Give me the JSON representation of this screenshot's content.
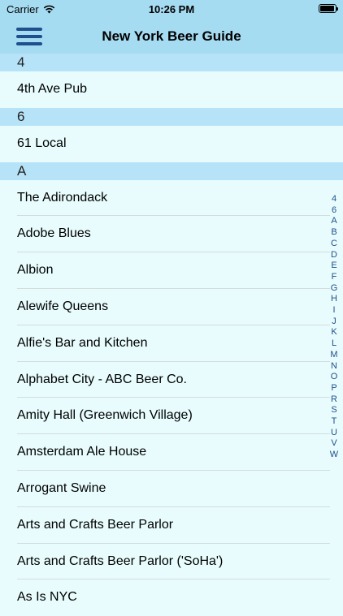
{
  "status": {
    "carrier": "Carrier",
    "time": "10:26 PM"
  },
  "nav": {
    "title": "New York Beer Guide"
  },
  "sections": [
    {
      "header": "4",
      "items": [
        "4th Ave Pub"
      ]
    },
    {
      "header": "6",
      "items": [
        "61 Local"
      ]
    },
    {
      "header": "A",
      "items": [
        "The Adirondack",
        "Adobe Blues",
        "Albion",
        "Alewife Queens",
        "Alfie's Bar and Kitchen",
        "Alphabet City - ABC Beer Co.",
        "Amity Hall (Greenwich Village)",
        "Amsterdam Ale House",
        "Arrogant Swine",
        "Arts and Crafts Beer Parlor",
        "Arts and Crafts Beer Parlor ('SoHa')",
        "As Is NYC"
      ]
    }
  ],
  "index": [
    "4",
    "6",
    "A",
    "B",
    "C",
    "D",
    "E",
    "F",
    "G",
    "H",
    "I",
    "J",
    "K",
    "L",
    "M",
    "N",
    "O",
    "P",
    "R",
    "S",
    "T",
    "U",
    "V",
    "W"
  ]
}
